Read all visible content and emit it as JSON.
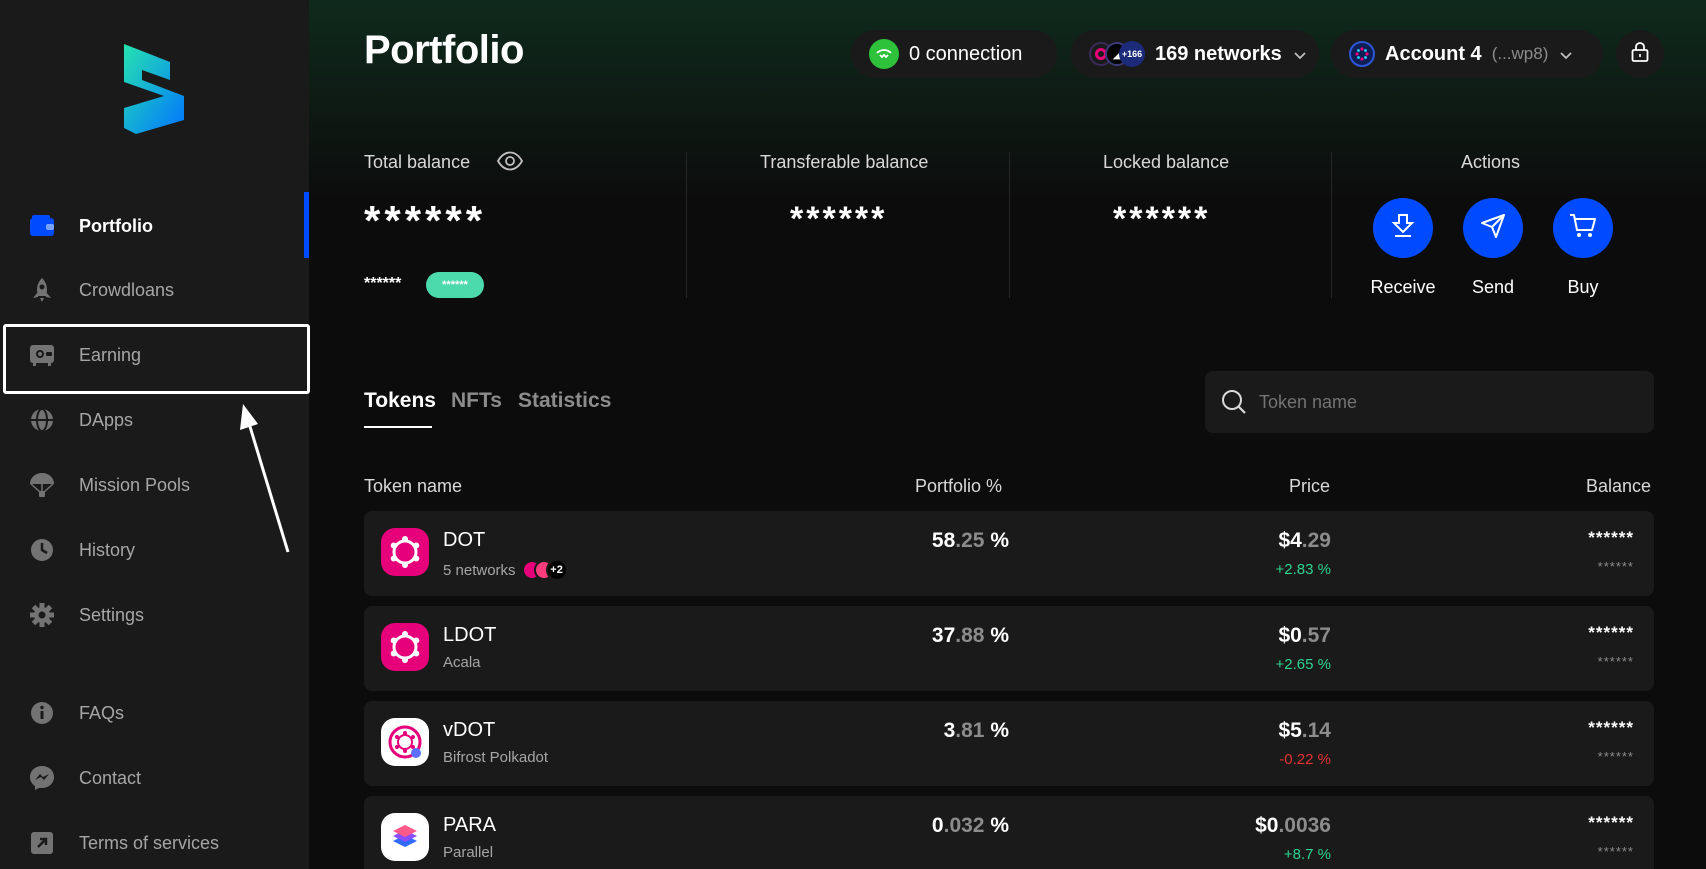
{
  "sidebar": {
    "items": [
      {
        "label": "Portfolio",
        "icon": "wallet-icon"
      },
      {
        "label": "Crowdloans",
        "icon": "rocket-icon"
      },
      {
        "label": "Earning",
        "icon": "safe-icon"
      },
      {
        "label": "DApps",
        "icon": "globe-icon"
      },
      {
        "label": "Mission Pools",
        "icon": "parachute-icon"
      },
      {
        "label": "History",
        "icon": "clock-icon"
      },
      {
        "label": "Settings",
        "icon": "gear-icon"
      }
    ],
    "footer": [
      {
        "label": "FAQs",
        "icon": "info-icon"
      },
      {
        "label": "Contact",
        "icon": "messenger-icon"
      },
      {
        "label": "Terms of services",
        "icon": "external-link-icon"
      }
    ]
  },
  "header": {
    "title": "Portfolio",
    "connection": "0 connection",
    "networks": "169 networks",
    "network_badge": "+166",
    "account_name": "Account 4",
    "account_address": "(...wp8)"
  },
  "balances": {
    "total_label": "Total balance",
    "total_value": "******",
    "total_sub": "******",
    "total_tag": "******",
    "transferable_label": "Transferable balance",
    "transferable_value": "******",
    "locked_label": "Locked balance",
    "locked_value": "******",
    "actions_label": "Actions",
    "receive": "Receive",
    "send": "Send",
    "buy": "Buy"
  },
  "tabs": [
    "Tokens",
    "NFTs",
    "Statistics"
  ],
  "search": {
    "placeholder": "Token name"
  },
  "table": {
    "headers": [
      "Token name",
      "Portfolio %",
      "Price",
      "Balance"
    ],
    "rows": [
      {
        "name": "DOT",
        "sub": "5 networks",
        "badge": "+2",
        "pct_int": "58",
        "pct_dec": ".25",
        "pct_unit": " %",
        "price_int": "$4",
        "price_dec": ".29",
        "change": "+2.83 %",
        "bal": "******",
        "bal_sub": "******"
      },
      {
        "name": "LDOT",
        "sub": "Acala",
        "pct_int": "37",
        "pct_dec": ".88",
        "pct_unit": " %",
        "price_int": "$0",
        "price_dec": ".57",
        "change": "+2.65 %",
        "bal": "******",
        "bal_sub": "******"
      },
      {
        "name": "vDOT",
        "sub": "Bifrost Polkadot",
        "pct_int": "3",
        "pct_dec": ".81",
        "pct_unit": " %",
        "price_int": "$5",
        "price_dec": ".14",
        "change": "-0.22 %",
        "bal": "******",
        "bal_sub": "******"
      },
      {
        "name": "PARA",
        "sub": "Parallel",
        "pct_int": "0",
        "pct_dec": ".032",
        "pct_unit": " %",
        "price_int": "$0",
        "price_dec": ".0036",
        "change": "+8.7 %",
        "bal": "******",
        "bal_sub": "******"
      }
    ]
  },
  "colors": {
    "accent": "#004bff",
    "positive": "#2dd48f",
    "negative": "#e33131",
    "tag": "#4cd9ac",
    "polkadot": "#e6007a"
  }
}
